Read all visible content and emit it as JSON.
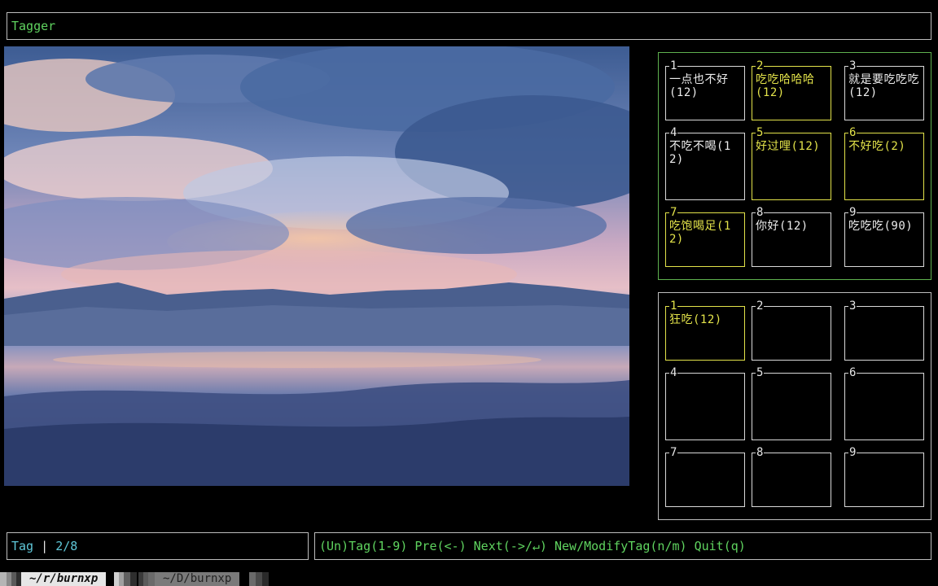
{
  "app": {
    "title": "Tagger"
  },
  "image": {
    "icon": "landscape-photo",
    "colors": {
      "sky_top": "#3e5f94",
      "sky_pink": "#e6b7c2",
      "sky_orange": "#f3c29b",
      "mountains": "#3a4f78",
      "water": "#5b6f9c",
      "shore": "#2c3f6e"
    }
  },
  "tag_panel": {
    "border_color": "#5fb14f",
    "cells": [
      {
        "num": "1",
        "label": "一点也不好(12)",
        "active": false
      },
      {
        "num": "2",
        "label": "吃吃哈哈哈(12)",
        "active": true
      },
      {
        "num": "3",
        "label": "就是要吃吃吃(12)",
        "active": false
      },
      {
        "num": "4",
        "label": "不吃不喝(12)",
        "active": false
      },
      {
        "num": "5",
        "label": "好过哩(12)",
        "active": true
      },
      {
        "num": "6",
        "label": "不好吃(2)",
        "active": true
      },
      {
        "num": "7",
        "label": "吃饱喝足(12)",
        "active": true
      },
      {
        "num": "8",
        "label": "你好(12)",
        "active": false
      },
      {
        "num": "9",
        "label": "吃吃吃(90)",
        "active": false
      }
    ]
  },
  "selected_panel": {
    "cells": [
      {
        "num": "1",
        "label": "狂吃(12)",
        "active": true
      },
      {
        "num": "2",
        "label": "",
        "active": false
      },
      {
        "num": "3",
        "label": "",
        "active": false
      },
      {
        "num": "4",
        "label": "",
        "active": false
      },
      {
        "num": "5",
        "label": "",
        "active": false
      },
      {
        "num": "6",
        "label": "",
        "active": false
      },
      {
        "num": "7",
        "label": "",
        "active": false
      },
      {
        "num": "8",
        "label": "",
        "active": false
      },
      {
        "num": "9",
        "label": "",
        "active": false
      }
    ]
  },
  "status": {
    "mode": "Tag",
    "separator": " | ",
    "count": "2/8"
  },
  "help": {
    "text": "(Un)Tag(1-9) Pre(<-) Next(->/↵) New/ModifyTag(n/m) Quit(q)"
  },
  "tmux": {
    "tabs": [
      {
        "label": "~/r/burnxp",
        "active": true
      },
      {
        "label": "~/D/burnxp",
        "active": false
      }
    ]
  },
  "colors": {
    "accent_green": "#5fd35f",
    "accent_yellow": "#e3e34a",
    "accent_cyan": "#5fc7d8"
  }
}
